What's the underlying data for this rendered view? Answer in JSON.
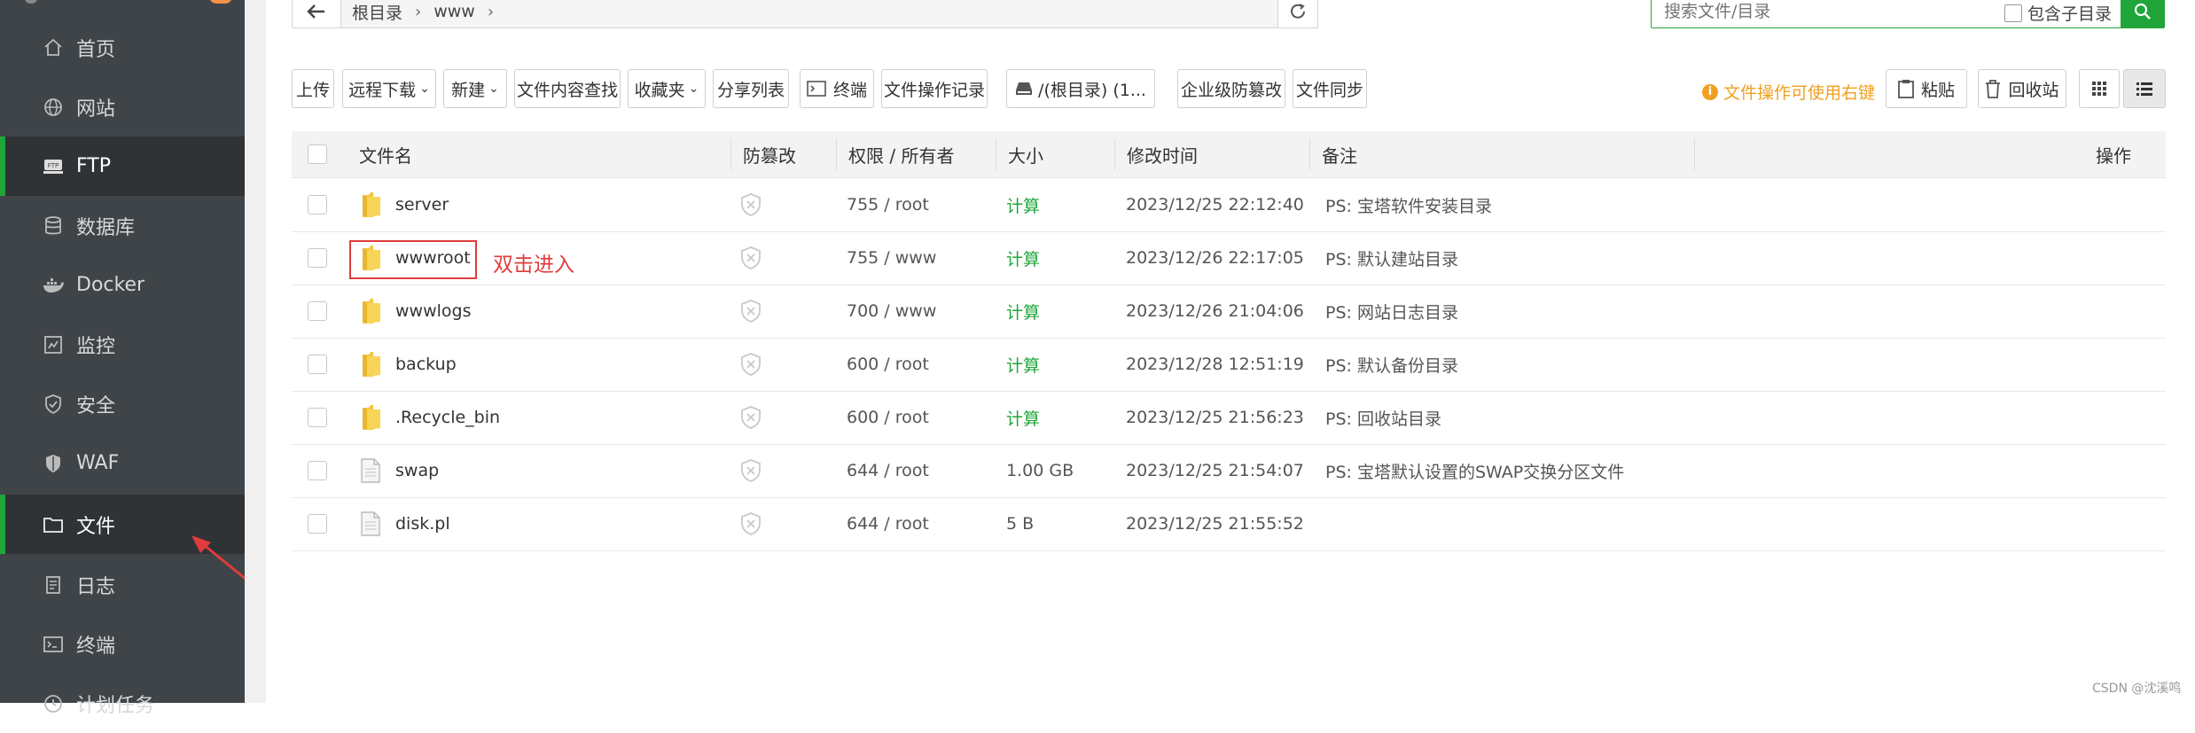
{
  "sidebar": {
    "items": [
      {
        "label": "首页",
        "icon": "home-icon",
        "active": false
      },
      {
        "label": "网站",
        "icon": "globe-icon",
        "active": false
      },
      {
        "label": "FTP",
        "icon": "ftp-icon",
        "active": true
      },
      {
        "label": "数据库",
        "icon": "database-icon",
        "active": false
      },
      {
        "label": "Docker",
        "icon": "docker-icon",
        "active": false
      },
      {
        "label": "监控",
        "icon": "monitor-icon",
        "active": false
      },
      {
        "label": "安全",
        "icon": "shield-check-icon",
        "active": false
      },
      {
        "label": "WAF",
        "icon": "waf-shield-icon",
        "active": false
      },
      {
        "label": "文件",
        "icon": "folder-icon",
        "active": true
      },
      {
        "label": "日志",
        "icon": "log-icon",
        "active": false
      },
      {
        "label": "终端",
        "icon": "terminal-icon",
        "active": false
      },
      {
        "label": "计划任务",
        "icon": "clock-icon",
        "active": false
      }
    ]
  },
  "path": {
    "crumbs": [
      "根目录",
      "www"
    ]
  },
  "search": {
    "placeholder": "搜索文件/目录",
    "subdir_label": "包含子目录"
  },
  "toolbar": {
    "upload": "上传",
    "remote_download": "远程下载",
    "new": "新建",
    "content_search": "文件内容查找",
    "favorites": "收藏夹",
    "share_list": "分享列表",
    "terminal": "终端",
    "op_log": "文件操作记录",
    "disk": "/(根目录) (1...",
    "anti_tamper": "企业级防篡改",
    "file_sync": "文件同步",
    "tip": "文件操作可使用右键",
    "paste": "粘贴",
    "recycle": "回收站"
  },
  "table": {
    "headers": {
      "name": "文件名",
      "tamper": "防篡改",
      "perm": "权限 / 所有者",
      "size": "大小",
      "mtime": "修改时间",
      "note": "备注",
      "ops": "操作"
    },
    "rows": [
      {
        "name": "server",
        "type": "folder",
        "perm": "755 / root",
        "size": "计算",
        "mtime": "2023/12/25 22:12:40",
        "note": "PS: 宝塔软件安装目录"
      },
      {
        "name": "wwwroot",
        "type": "folder",
        "perm": "755 / www",
        "size": "计算",
        "mtime": "2023/12/26 22:17:05",
        "note": "PS: 默认建站目录"
      },
      {
        "name": "wwwlogs",
        "type": "folder",
        "perm": "700 / www",
        "size": "计算",
        "mtime": "2023/12/26 21:04:06",
        "note": "PS: 网站日志目录"
      },
      {
        "name": "backup",
        "type": "folder",
        "perm": "600 / root",
        "size": "计算",
        "mtime": "2023/12/28 12:51:19",
        "note": "PS: 默认备份目录"
      },
      {
        "name": ".Recycle_bin",
        "type": "folder",
        "perm": "600 / root",
        "size": "计算",
        "mtime": "2023/12/25 21:56:23",
        "note": "PS:  回收站目录"
      },
      {
        "name": "swap",
        "type": "file",
        "perm": "644 / root",
        "size": "1.00 GB",
        "mtime": "2023/12/25 21:54:07",
        "note": "PS: 宝塔默认设置的SWAP交换分区文件"
      },
      {
        "name": "disk.pl",
        "type": "file",
        "perm": "644 / root",
        "size": "5 B",
        "mtime": "2023/12/25 21:55:52",
        "note": ""
      }
    ]
  },
  "annotation": {
    "text": "双击进入"
  },
  "watermark": "CSDN @沈溪鸣",
  "colors": {
    "accent": "#20a53a",
    "sidebar_bg": "#3f4448",
    "warning": "#f0a020",
    "annotation": "#e03c3c"
  }
}
